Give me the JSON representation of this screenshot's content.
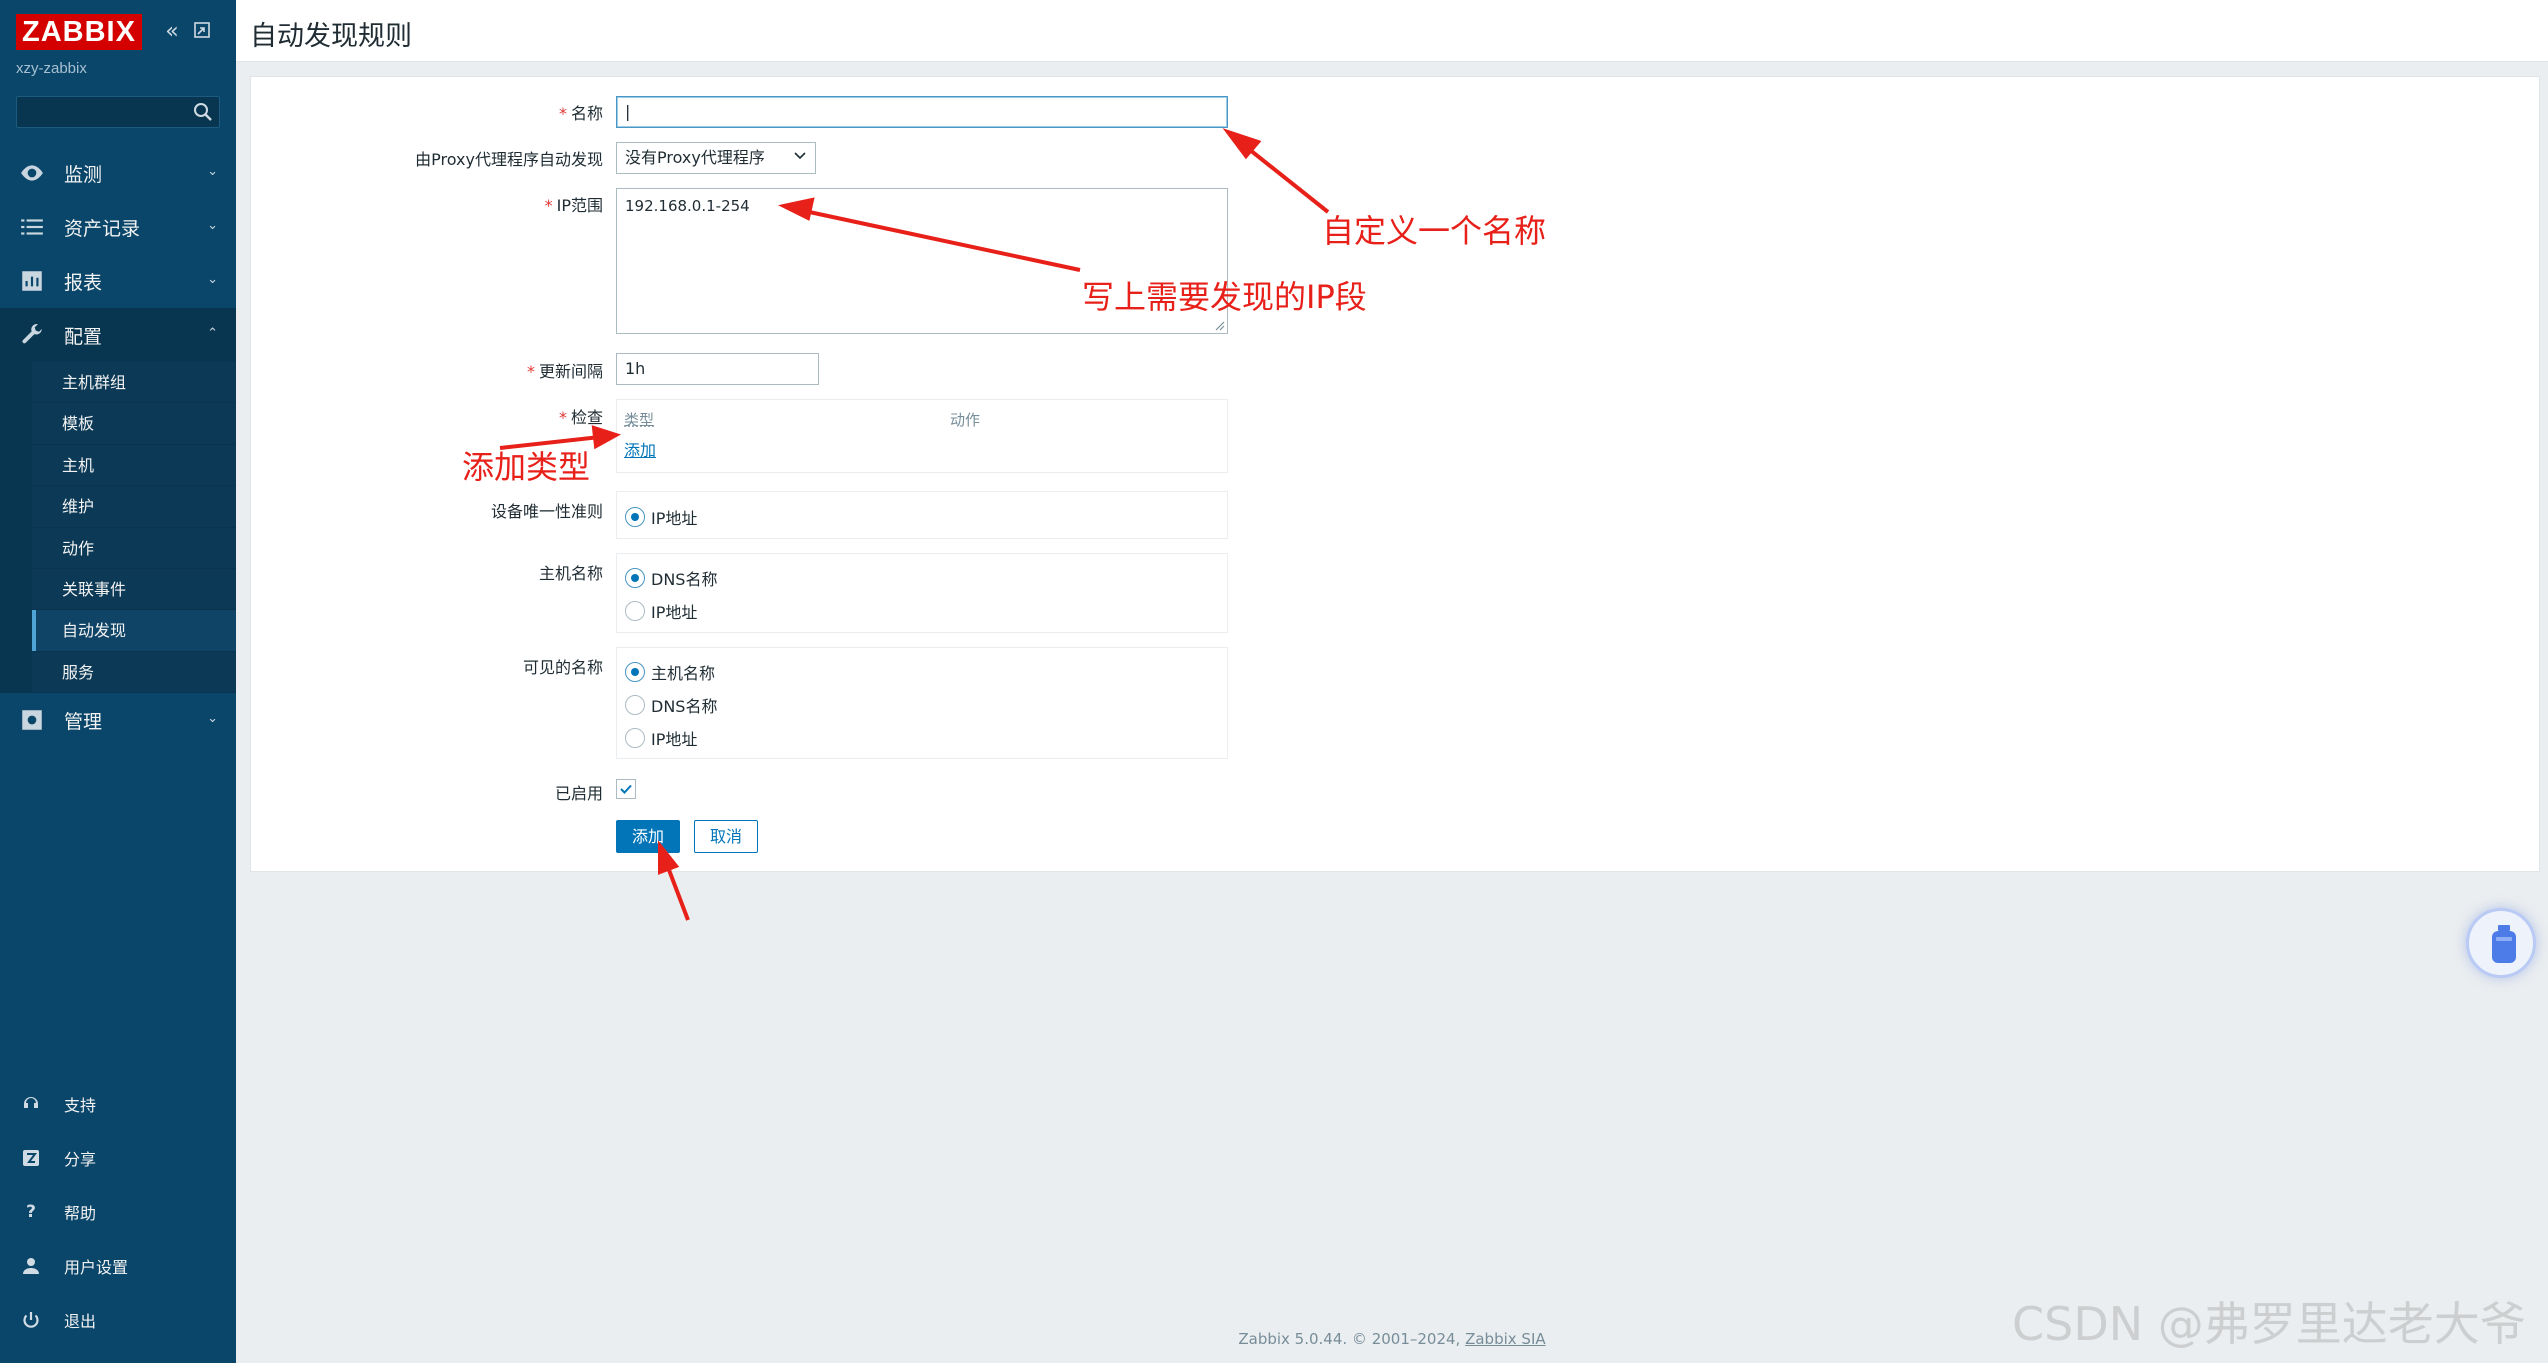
{
  "sidebar": {
    "logo": "ZABBIX",
    "server_name": "xzy-zabbix",
    "search": {
      "value": "",
      "placeholder": ""
    },
    "menu": [
      {
        "label": "监测",
        "icon": "eye-icon"
      },
      {
        "label": "资产记录",
        "icon": "list-icon"
      },
      {
        "label": "报表",
        "icon": "bar-chart-icon"
      },
      {
        "label": "配置",
        "icon": "wrench-icon"
      },
      {
        "label": "管理",
        "icon": "gear-icon"
      }
    ],
    "config_submenu": [
      "主机群组",
      "模板",
      "主机",
      "维护",
      "动作",
      "关联事件",
      "自动发现",
      "服务"
    ],
    "bottom": [
      {
        "label": "支持",
        "icon": "headset-icon"
      },
      {
        "label": "分享",
        "icon": "zabbix-share-icon"
      },
      {
        "label": "帮助",
        "icon": "help-icon"
      },
      {
        "label": "用户设置",
        "icon": "user-icon"
      },
      {
        "label": "退出",
        "icon": "power-icon"
      }
    ]
  },
  "header": {
    "title": "自动发现规则"
  },
  "form": {
    "name_label": "名称",
    "name_value": "",
    "proxy_label": "由Proxy代理程序自动发现",
    "proxy_value": "没有Proxy代理程序",
    "ip_range_label": "IP范围",
    "ip_range_value": "192.168.0.1-254",
    "interval_label": "更新间隔",
    "interval_value": "1h",
    "checks_label": "检查",
    "checks_col_type": "类型",
    "checks_col_action": "动作",
    "checks_add": "添加",
    "uniqueness_label": "设备唯一性准则",
    "uniqueness_options": [
      "IP地址"
    ],
    "hostname_label": "主机名称",
    "hostname_options": [
      "DNS名称",
      "IP地址"
    ],
    "visible_name_label": "可见的名称",
    "visible_name_options": [
      "主机名称",
      "DNS名称",
      "IP地址"
    ],
    "enabled_label": "已启用",
    "enabled": true,
    "submit_label": "添加",
    "cancel_label": "取消"
  },
  "footer": {
    "text": "Zabbix 5.0.44. © 2001–2024, ",
    "link": "Zabbix SIA"
  },
  "annotations": {
    "name": "自定义一个名称",
    "ip": "写上需要发现的IP段",
    "type": "添加类型"
  },
  "watermark": "CSDN @弗罗里达老大爷",
  "colors": {
    "sidebar": "#0a466a",
    "accent": "#0275b8",
    "logo": "#d40000",
    "annotation": "#e8201a"
  }
}
